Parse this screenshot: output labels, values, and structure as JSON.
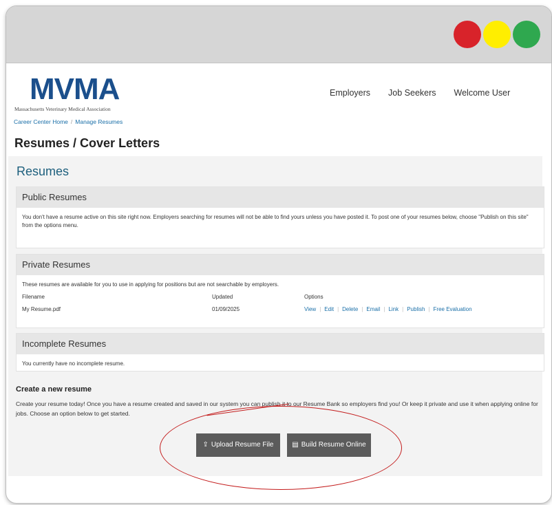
{
  "window": {
    "controls": {
      "close_color": "#d8232a",
      "minimize_color": "#ffee00",
      "maximize_color": "#2fa84f"
    }
  },
  "header": {
    "logo_text": "MVMA",
    "logo_subtitle": "Massachusetts Veterinary Medical Association",
    "nav": [
      "Employers",
      "Job Seekers",
      "Welcome User"
    ]
  },
  "breadcrumb": [
    "Career Center Home",
    "Manage Resumes"
  ],
  "page_title": "Resumes / Cover Letters",
  "panel_title": "Resumes",
  "public": {
    "title": "Public Resumes",
    "text": "You don't have a resume active on this site right now. Employers searching for resumes will not be able to find yours unless you have posted it. To post one of your resumes below, choose \"Publish on this site\" from the options menu."
  },
  "private": {
    "title": "Private Resumes",
    "text": "These resumes are available for you to use in applying for positions but are not searchable by employers.",
    "headers": [
      "Filename",
      "Updated",
      "Options"
    ],
    "rows": [
      {
        "filename": "My Resume.pdf",
        "updated": "01/09/2025"
      }
    ],
    "options": [
      "View",
      "Edit",
      "Delete",
      "Email",
      "Link",
      "Publish",
      "Free Evaluation"
    ]
  },
  "incomplete": {
    "title": "Incomplete Resumes",
    "text": "You currently have no incomplete resume."
  },
  "create": {
    "title": "Create a new resume",
    "text": "Create your resume today! Once you have a resume created and saved in our system you can publish it to our Resume Bank so employers find you! Or keep it private and use it when applying online for jobs. Choose an option below to get started.",
    "upload_label": "Upload Resume File",
    "build_label": "Build Resume Online"
  },
  "colors": {
    "accent": "#1d5f7d",
    "link": "#1a6fa8",
    "button": "#5b5b5b",
    "annotation": "#c31a1a"
  }
}
